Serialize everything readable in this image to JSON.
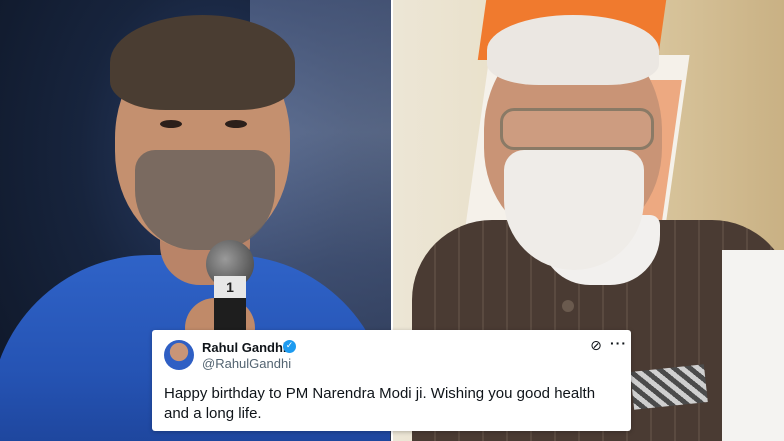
{
  "tweet": {
    "author_name": "Rahul Gandhi",
    "author_handle": "@RahulGandhi",
    "verified_icon": "verified-badge-icon",
    "grok_icon": "grok-icon",
    "more_label": "···",
    "text": "Happy birthday to PM Narendra Modi ji. Wishing you good health and a long life."
  },
  "photo_left": {
    "mic_tag": "1"
  },
  "colors": {
    "verified_blue": "#1d9bf0",
    "tweet_text": "#0f1419",
    "handle_gray": "#536471"
  }
}
